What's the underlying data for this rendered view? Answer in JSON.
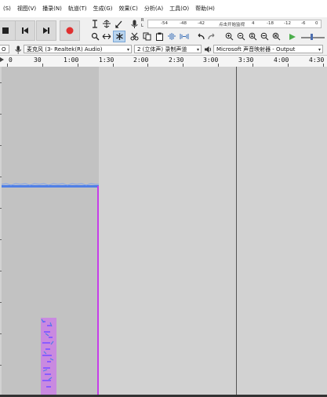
{
  "menu": {
    "items": [
      "(S)",
      "视图(V)",
      "播录(N)",
      "轨道(T)",
      "生成(G)",
      "效果(C)",
      "分析(A)",
      "工具(O)",
      "帮助(H)"
    ]
  },
  "toolbar": {
    "meter_hint": "点击开始监视",
    "meter_scale_left": [
      "-54",
      "-48",
      "-42"
    ],
    "meter_scale_right": [
      "4",
      "-18",
      "-12",
      "-6",
      "0"
    ],
    "meter_label_r": "R",
    "meter_label_l": "L"
  },
  "devices": {
    "host_suffix": "O",
    "input_device": "麦克风 (3- Realtek(R) Audio)",
    "channels": "2 (立体声) 录制声道",
    "output_device": "Microsoft 声音映射器 - Output"
  },
  "timeline": {
    "labels": [
      "0",
      "30",
      "1:00",
      "1:30",
      "2:00",
      "2:30",
      "3:00",
      "3:30",
      "4:00",
      "4:30"
    ]
  },
  "colors": {
    "clip_background": "#c2c2c2",
    "waveform_blue": "#4f7fe6",
    "spectrum_magenta": "#c63de8",
    "record_red": "#e03030"
  }
}
